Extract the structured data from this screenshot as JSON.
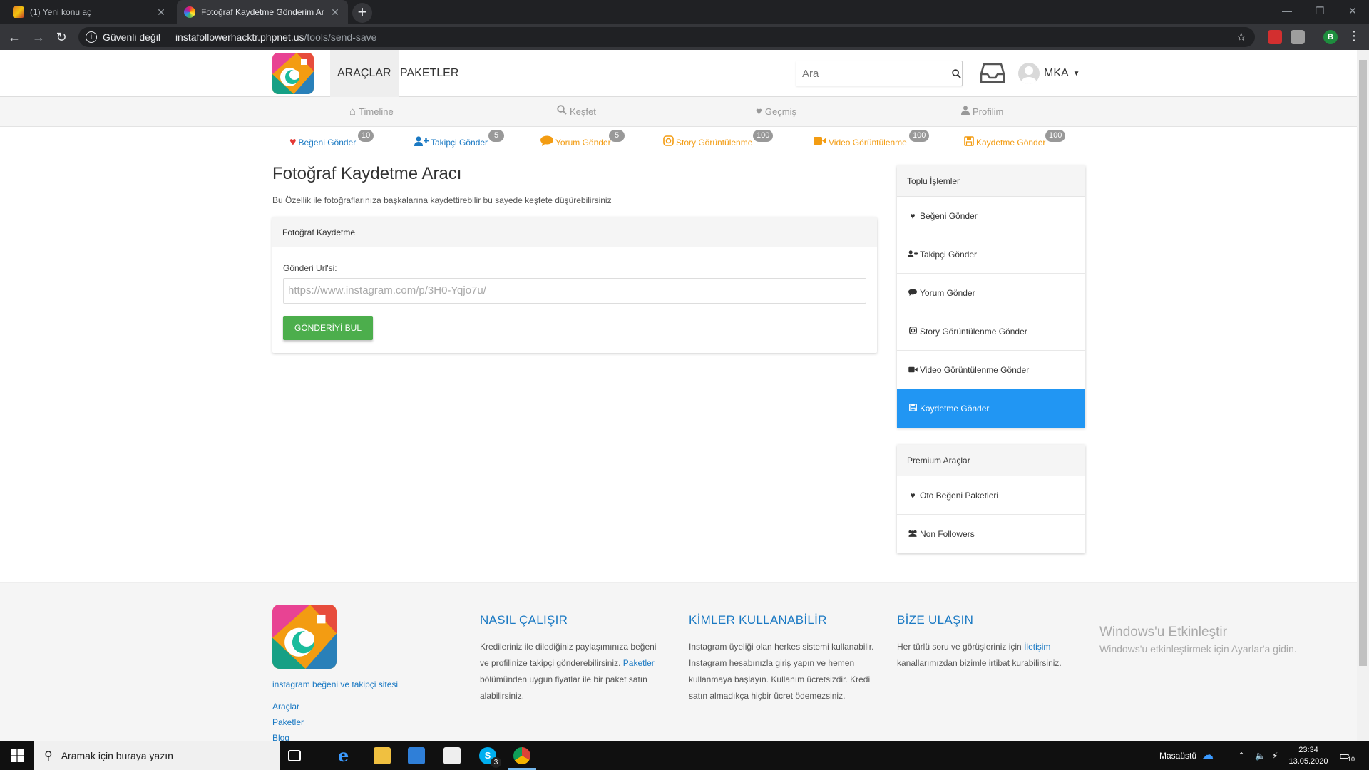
{
  "browser": {
    "tabs": [
      {
        "title": "(1) Yeni konu aç",
        "active": false
      },
      {
        "title": "Fotoğraf Kaydetme Gönderim Ar",
        "active": true
      }
    ],
    "security_label": "Güvenli değil",
    "url_host": "instafollowerhacktr.phpnet.us",
    "url_path": "/tools/send-save",
    "profile_initial": "B"
  },
  "navbar": {
    "links": [
      {
        "label": "ARAÇLAR",
        "active": true
      },
      {
        "label": "PAKETLER",
        "active": false
      }
    ],
    "search_placeholder": "Ara",
    "username": "MKA"
  },
  "subnav": [
    {
      "label": "Timeline",
      "icon": "home-icon"
    },
    {
      "label": "Keşfet",
      "icon": "search-icon"
    },
    {
      "label": "Geçmiş",
      "icon": "heart-icon"
    },
    {
      "label": "Profilim",
      "icon": "user-icon"
    }
  ],
  "credits": [
    {
      "label": "Beğeni Gönder",
      "count": "10",
      "icon": "heart-icon",
      "color": "#e53935"
    },
    {
      "label": "Takipçi Gönder",
      "count": "5",
      "icon": "user-plus-icon",
      "color": "#1a79c3"
    },
    {
      "label": "Yorum Gönder",
      "count": "5",
      "icon": "comment-icon",
      "color": "#f39c12"
    },
    {
      "label": "Story Görüntülenme",
      "count": "100",
      "icon": "instagram-icon",
      "color": "#f39c12"
    },
    {
      "label": "Video Görüntülenme",
      "count": "100",
      "icon": "video-icon",
      "color": "#f39c12"
    },
    {
      "label": "Kaydetme Gönder",
      "count": "100",
      "icon": "save-icon",
      "color": "#f39c12"
    }
  ],
  "main": {
    "title": "Fotoğraf Kaydetme Aracı",
    "description": "Bu Özellik ile fotoğraflarınıza başkalarına kaydettirebilir bu sayede keşfete düşürebilirsiniz",
    "panel_title": "Fotoğraf Kaydetme",
    "field_label": "Gönderi Url'si:",
    "field_placeholder": "https://www.instagram.com/p/3H0-Yqjo7u/",
    "button_label": "GÖNDERİYİ BUL"
  },
  "sidebar": {
    "bulk_title": "Toplu İşlemler",
    "bulk_items": [
      {
        "label": "Beğeni Gönder",
        "icon": "heart-icon",
        "active": false
      },
      {
        "label": "Takipçi Gönder",
        "icon": "user-plus-icon",
        "active": false
      },
      {
        "label": "Yorum Gönder",
        "icon": "comment-icon",
        "active": false
      },
      {
        "label": "Story Görüntülenme Gönder",
        "icon": "instagram-icon",
        "active": false
      },
      {
        "label": "Video Görüntülenme Gönder",
        "icon": "video-icon",
        "active": false
      },
      {
        "label": "Kaydetme Gönder",
        "icon": "save-icon",
        "active": true
      }
    ],
    "premium_title": "Premium Araçlar",
    "premium_items": [
      {
        "label": "Oto Beğeni Paketleri",
        "icon": "heartbeat-icon"
      },
      {
        "label": "Non Followers",
        "icon": "users-icon"
      }
    ]
  },
  "footer": {
    "tagline": "instagram beğeni ve takipçi sitesi",
    "links": [
      "Araçlar",
      "Paketler",
      "Blog"
    ],
    "how": {
      "title": "NASIL ÇALIŞIR",
      "text_1": "Kredileriniz ile dilediğiniz paylaşımınıza beğeni ve profilinize takipçi gönderebilirsiniz.",
      "link": "Paketler",
      "text_2": "bölümünden uygun fiyatlar ile bir paket satın alabilirsiniz."
    },
    "who": {
      "title": "KİMLER KULLANABİLİR",
      "text": "Instagram üyeliği olan herkes sistemi kullanabilir. Instagram hesabınızla giriş yapın ve hemen kullanmaya başlayın. Kullanım ücretsizdir. Kredi satın almadıkça hiçbir ücret ödemezsiniz."
    },
    "contact": {
      "title": "BİZE ULAŞIN",
      "text_1": "Her türlü soru ve görüşleriniz için",
      "link": "İletişim",
      "text_2": "kanallarımızdan bizimle irtibat kurabilirsiniz."
    }
  },
  "watermark": {
    "line1": "Windows'u Etkinleştir",
    "line2": "Windows'u etkinleştirmek için Ayarlar'a gidin."
  },
  "taskbar": {
    "search_placeholder": "Aramak için buraya yazın",
    "desktop_label": "Masaüstü",
    "skype_badge": "3",
    "time": "23:34",
    "date": "13.05.2020",
    "notification_count": "10"
  },
  "colors": {
    "accent_blue": "#2196f3",
    "link_blue": "#1a79c3",
    "button_green": "#4cae4c",
    "orange": "#f39c12",
    "heart_red": "#e53935"
  }
}
